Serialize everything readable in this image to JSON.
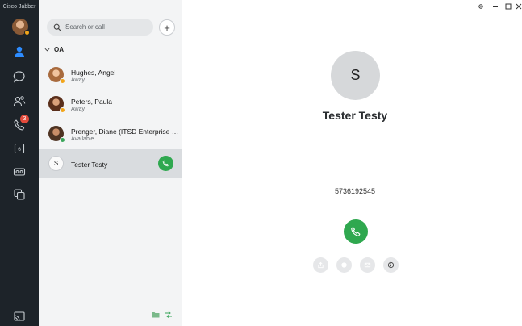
{
  "app": {
    "title": "Cisco Jabber"
  },
  "rail": {
    "items": [
      {
        "icon": "contacts-icon",
        "active": true
      },
      {
        "icon": "chat-icon"
      },
      {
        "icon": "meetings-people-icon"
      },
      {
        "icon": "phone-icon",
        "badge": "3"
      },
      {
        "icon": "calendar-icon",
        "label": "6"
      },
      {
        "icon": "voicemail-icon"
      },
      {
        "icon": "rooms-icon"
      }
    ],
    "footer_icon": "cast-icon"
  },
  "search": {
    "placeholder": "Search or call"
  },
  "group": {
    "name": "OA"
  },
  "contacts": [
    {
      "name": "Hughes, Angel",
      "status": "Away",
      "presence": "away"
    },
    {
      "name": "Peters, Paula",
      "status": "Away",
      "presence": "away"
    },
    {
      "name": "Prenger, Diane  (ITSD Enterprise Re...",
      "status": "Available",
      "presence": "available"
    },
    {
      "name": "Tester Testy",
      "initial": "S",
      "selected": true
    }
  ],
  "detail": {
    "initial": "S",
    "name": "Tester Testy",
    "number": "5736192545"
  },
  "colors": {
    "accent_green": "#2fa84f",
    "rail_bg": "#1d2329",
    "away": "#f2a51a",
    "available": "#3aa55a",
    "badge": "#e24a3b"
  }
}
